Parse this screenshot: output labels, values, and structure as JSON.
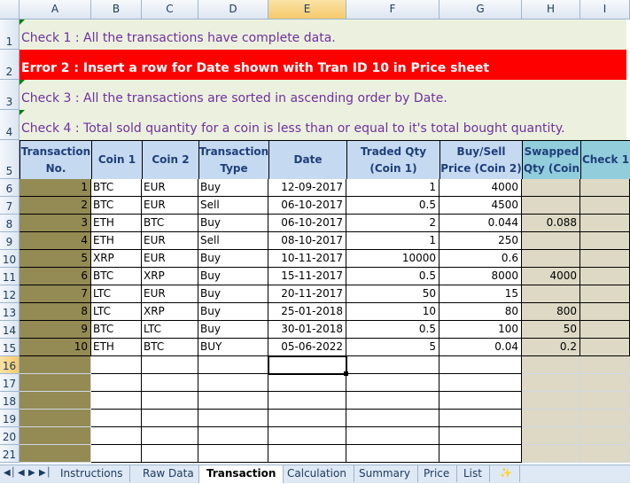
{
  "columns": [
    "A",
    "B",
    "C",
    "D",
    "E",
    "F",
    "G",
    "H",
    "I"
  ],
  "selected_column": "E",
  "selected_row": "16",
  "rows": [
    "1",
    "2",
    "3",
    "4",
    "5",
    "6",
    "7",
    "8",
    "9",
    "10",
    "11",
    "12",
    "13",
    "14",
    "15",
    "16",
    "17",
    "18",
    "19",
    "20",
    "21"
  ],
  "checks": [
    {
      "text": "Check 1 : All the transactions have complete data.",
      "status": "ok"
    },
    {
      "text": "Error 2 : Insert a row for Date shown with Tran ID 10 in Price sheet",
      "status": "error"
    },
    {
      "text": "Check 3 : All the transactions are sorted in ascending order by Date.",
      "status": "ok"
    },
    {
      "text": "Check 4 : Total sold quantity for a coin is less than or equal to it's total bought quantity.",
      "status": "ok"
    }
  ],
  "table": {
    "headers": {
      "transaction_no": "Transaction No.",
      "coin1": "Coin 1",
      "coin2": "Coin 2",
      "type": "Transaction Type",
      "date": "Date",
      "traded_qty": "Traded Qty (Coin 1)",
      "price": "Buy/Sell Price (Coin 2)",
      "swapped": "Swapped Qty (Coin",
      "check": "Check 1"
    },
    "records": [
      {
        "no": "1",
        "coin1": "BTC",
        "coin2": "EUR",
        "type": "Buy",
        "date": "12-09-2017",
        "qty": "1",
        "price": "4000",
        "swapped": ""
      },
      {
        "no": "2",
        "coin1": "BTC",
        "coin2": "EUR",
        "type": "Sell",
        "date": "06-10-2017",
        "qty": "0.5",
        "price": "4500",
        "swapped": ""
      },
      {
        "no": "3",
        "coin1": "ETH",
        "coin2": "BTC",
        "type": "Buy",
        "date": "06-10-2017",
        "qty": "2",
        "price": "0.044",
        "swapped": "0.088"
      },
      {
        "no": "4",
        "coin1": "ETH",
        "coin2": "EUR",
        "type": "Sell",
        "date": "08-10-2017",
        "qty": "1",
        "price": "250",
        "swapped": ""
      },
      {
        "no": "5",
        "coin1": "XRP",
        "coin2": "EUR",
        "type": "Buy",
        "date": "10-11-2017",
        "qty": "10000",
        "price": "0.6",
        "swapped": ""
      },
      {
        "no": "6",
        "coin1": "BTC",
        "coin2": "XRP",
        "type": "Buy",
        "date": "15-11-2017",
        "qty": "0.5",
        "price": "8000",
        "swapped": "4000"
      },
      {
        "no": "7",
        "coin1": "LTC",
        "coin2": "EUR",
        "type": "Buy",
        "date": "20-11-2017",
        "qty": "50",
        "price": "15",
        "swapped": ""
      },
      {
        "no": "8",
        "coin1": "LTC",
        "coin2": "XRP",
        "type": "Buy",
        "date": "25-01-2018",
        "qty": "10",
        "price": "80",
        "swapped": "800"
      },
      {
        "no": "9",
        "coin1": "BTC",
        "coin2": "LTC",
        "type": "Buy",
        "date": "30-01-2018",
        "qty": "0.5",
        "price": "100",
        "swapped": "50"
      },
      {
        "no": "10",
        "coin1": "ETH",
        "coin2": "BTC",
        "type": "BUY",
        "date": "05-06-2022",
        "qty": "5",
        "price": "0.04",
        "swapped": "0.2"
      }
    ]
  },
  "sheet_tabs": [
    "Instructions",
    "Raw Data",
    "Transaction",
    "Calculation",
    "Summary",
    "Price",
    "List"
  ],
  "active_tab": "Transaction",
  "colors": {
    "check_ok_bg": "#ebf1de",
    "check_ok_text": "#7030a0",
    "error_bg": "#ff0000",
    "header_bg": "#c5d9f1",
    "header_teal_bg": "#92cddc",
    "id_column_bg": "#948a54",
    "tan_column_bg": "#ddd9c4"
  }
}
